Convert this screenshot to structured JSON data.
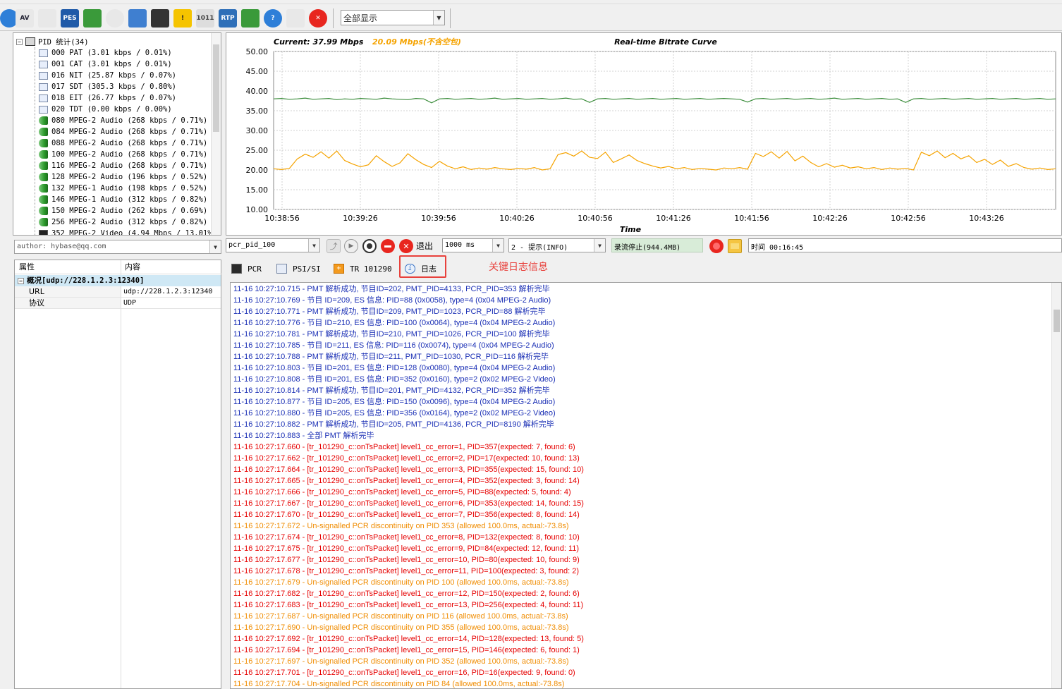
{
  "toolbar": {
    "buttons": [
      {
        "name": "globe-icon",
        "label": ""
      },
      {
        "name": "av-icon",
        "label": "AV"
      },
      {
        "name": "waveform-icon",
        "label": ""
      },
      {
        "name": "pes-icon",
        "label": "PES"
      },
      {
        "name": "line-chart-icon",
        "label": ""
      },
      {
        "name": "clock-icon",
        "label": ""
      },
      {
        "name": "bar-chart-icon",
        "label": ""
      },
      {
        "name": "monitor-icon",
        "label": ""
      },
      {
        "name": "warning-icon",
        "label": "!"
      },
      {
        "name": "binary-icon",
        "label": "1011"
      },
      {
        "name": "rtp-icon",
        "label": "RTP"
      },
      {
        "name": "image-icon",
        "label": ""
      },
      {
        "name": "help-icon",
        "label": "?"
      },
      {
        "name": "list-icon",
        "label": ""
      },
      {
        "name": "stop-icon",
        "label": "✕"
      }
    ],
    "view_mode": "全部显示"
  },
  "pid_tree": {
    "root_label": "PID 统计(34)",
    "items": [
      {
        "icon": "doc",
        "label": "000 PAT (3.01 kbps / 0.01%)"
      },
      {
        "icon": "doc",
        "label": "001 CAT (3.01 kbps / 0.01%)"
      },
      {
        "icon": "doc",
        "label": "016 NIT (25.87 kbps / 0.07%)"
      },
      {
        "icon": "doc",
        "label": "017 SDT (305.3 kbps / 0.80%)"
      },
      {
        "icon": "doc",
        "label": "018 EIT (26.77 kbps / 0.07%)"
      },
      {
        "icon": "doc",
        "label": "020 TDT (0.00 kbps / 0.00%)"
      },
      {
        "icon": "audio",
        "label": "080 MPEG-2 Audio (268 kbps / 0.71%)"
      },
      {
        "icon": "audio",
        "label": "084 MPEG-2 Audio (268 kbps / 0.71%)"
      },
      {
        "icon": "audio",
        "label": "088 MPEG-2 Audio (268 kbps / 0.71%)"
      },
      {
        "icon": "audio",
        "label": "100 MPEG-2 Audio (268 kbps / 0.71%)"
      },
      {
        "icon": "audio",
        "label": "116 MPEG-2 Audio (268 kbps / 0.71%)"
      },
      {
        "icon": "audio",
        "label": "128 MPEG-2 Audio (196 kbps / 0.52%)"
      },
      {
        "icon": "audio",
        "label": "132 MPEG-1 Audio (198 kbps / 0.52%)"
      },
      {
        "icon": "audio",
        "label": "146 MPEG-1 Audio (312 kbps / 0.82%)"
      },
      {
        "icon": "audio",
        "label": "150 MPEG-2 Audio (262 kbps / 0.69%)"
      },
      {
        "icon": "audio",
        "label": "256 MPEG-2 Audio (312 kbps / 0.82%)"
      },
      {
        "icon": "video",
        "label": "352 MPEG-2 Video (4.94 Mbps / 13.01%)"
      }
    ]
  },
  "author": "author: hybase@qq.com",
  "properties": {
    "col_property": "属性",
    "col_content": "内容",
    "group": "概况[udp://228.1.2.3:12340]",
    "rows": [
      {
        "key": "URL",
        "value": "udp://228.1.2.3:12340"
      },
      {
        "key": "协议",
        "value": "UDP"
      }
    ]
  },
  "chart_data": {
    "type": "line",
    "title": "Real-time Bitrate Curve",
    "current_label": "Current: 37.99 Mbps",
    "secondary_label": "20.09 Mbps(不含空包)",
    "xlabel": "Time",
    "ylabel": "",
    "ylim": [
      10,
      50
    ],
    "yticks": [
      "10.00",
      "15.00",
      "20.00",
      "25.00",
      "30.00",
      "35.00",
      "40.00",
      "45.00",
      "50.00"
    ],
    "x": [
      "10:38:56",
      "10:39:26",
      "10:39:56",
      "10:40:26",
      "10:40:56",
      "10:41:26",
      "10:41:56",
      "10:42:26",
      "10:42:56",
      "10:43:26"
    ],
    "colors": {
      "total": "#3f8f3f",
      "no_null": "#f5a300"
    },
    "series": [
      {
        "key": "total",
        "values": [
          38.0,
          38.1,
          37.9,
          38.0,
          38.2,
          37.9,
          38.0,
          38.1,
          37.8,
          38.0,
          37.9,
          38.1,
          38.0,
          37.9,
          38.2,
          38.0,
          37.9,
          37.8,
          38.1,
          38.0,
          37.0,
          38.0,
          38.1,
          37.9,
          38.0,
          38.1,
          37.9,
          38.0,
          38.2,
          37.9,
          38.0,
          38.1,
          37.9,
          38.0,
          38.1,
          37.9,
          38.0,
          38.2,
          37.9,
          38.0,
          37.1,
          38.0,
          38.1,
          37.9,
          38.0,
          38.1,
          37.9,
          38.0,
          38.1,
          37.9,
          38.0,
          38.1,
          37.9,
          38.0,
          38.1,
          37.9,
          38.0,
          38.1,
          38.0,
          37.9,
          37.2,
          38.0,
          38.1,
          37.9,
          38.0,
          38.1,
          37.9,
          38.0,
          38.1,
          37.9,
          38.0,
          38.2,
          37.9,
          38.0,
          38.1,
          37.9,
          38.0,
          38.1,
          37.9,
          38.0,
          37.1,
          38.0,
          38.1,
          37.9,
          38.0,
          38.1,
          37.9,
          38.0,
          38.1,
          37.9,
          38.0,
          38.1,
          37.9,
          38.0,
          38.1,
          37.9,
          38.0,
          38.1,
          37.9,
          38.0
        ]
      },
      {
        "key": "no_null",
        "values": [
          20.3,
          20.1,
          20.4,
          22.8,
          24.0,
          23.2,
          24.6,
          23.0,
          24.8,
          22.4,
          21.5,
          20.8,
          21.3,
          23.6,
          22.1,
          20.9,
          21.8,
          24.1,
          22.6,
          21.4,
          20.6,
          22.2,
          21.0,
          20.3,
          20.8,
          20.1,
          20.5,
          20.2,
          20.6,
          20.3,
          20.1,
          20.4,
          20.2,
          20.6,
          20.0,
          20.3,
          23.9,
          24.4,
          23.5,
          24.8,
          23.2,
          22.9,
          24.5,
          21.9,
          22.8,
          23.8,
          22.4,
          21.6,
          21.0,
          20.5,
          20.9,
          20.3,
          20.6,
          20.1,
          20.4,
          20.2,
          20.0,
          20.5,
          20.3,
          20.6,
          20.2,
          24.2,
          23.4,
          24.6,
          23.0,
          24.7,
          22.3,
          23.5,
          21.9,
          20.8,
          21.6,
          20.7,
          21.2,
          20.5,
          20.8,
          20.3,
          20.6,
          20.1,
          20.5,
          20.2,
          20.4,
          20.0,
          24.5,
          23.6,
          24.8,
          23.1,
          24.2,
          22.8,
          23.6,
          21.9,
          22.7,
          21.4,
          22.5,
          20.9,
          21.6,
          20.6,
          20.2,
          20.5,
          20.1,
          20.3
        ]
      }
    ]
  },
  "controls": {
    "pid_select": "pcr_pid_100",
    "exit_label": "退出",
    "interval_select": "1000 ms",
    "log_level_select": "2 - 提示(INFO)",
    "record_status": "录流停止(944.4MB)",
    "time_label": "时间 00:16:45"
  },
  "tabs": [
    {
      "name": "pcr",
      "label": "PCR"
    },
    {
      "name": "psisi",
      "label": "PSI/SI"
    },
    {
      "name": "tr101290",
      "label": "TR 101290"
    },
    {
      "name": "log",
      "label": "日志"
    }
  ],
  "annotation": "关键日志信息",
  "log": [
    {
      "level": "info",
      "text": "11-16 10:27:10.715 - PMT 解析成功, 节目ID=202, PMT_PID=4133, PCR_PID=353 解析完毕"
    },
    {
      "level": "info",
      "text": "11-16 10:27:10.769 - 节目 ID=209, ES 信息: PID=88 (0x0058), type=4 (0x04 MPEG-2 Audio)"
    },
    {
      "level": "info",
      "text": "11-16 10:27:10.771 - PMT 解析成功, 节目ID=209, PMT_PID=1023, PCR_PID=88 解析完毕"
    },
    {
      "level": "info",
      "text": "11-16 10:27:10.776 - 节目 ID=210, ES 信息: PID=100 (0x0064), type=4 (0x04 MPEG-2 Audio)"
    },
    {
      "level": "info",
      "text": "11-16 10:27:10.781 - PMT 解析成功, 节目ID=210, PMT_PID=1026, PCR_PID=100 解析完毕"
    },
    {
      "level": "info",
      "text": "11-16 10:27:10.785 - 节目 ID=211, ES 信息: PID=116 (0x0074), type=4 (0x04 MPEG-2 Audio)"
    },
    {
      "level": "info",
      "text": "11-16 10:27:10.788 - PMT 解析成功, 节目ID=211, PMT_PID=1030, PCR_PID=116 解析完毕"
    },
    {
      "level": "info",
      "text": "11-16 10:27:10.803 - 节目 ID=201, ES 信息: PID=128 (0x0080), type=4 (0x04 MPEG-2 Audio)"
    },
    {
      "level": "info",
      "text": "11-16 10:27:10.808 - 节目 ID=201, ES 信息: PID=352 (0x0160), type=2 (0x02 MPEG-2 Video)"
    },
    {
      "level": "info",
      "text": "11-16 10:27:10.814 - PMT 解析成功, 节目ID=201, PMT_PID=4132, PCR_PID=352 解析完毕"
    },
    {
      "level": "info",
      "text": "11-16 10:27:10.877 - 节目 ID=205, ES 信息: PID=150 (0x0096), type=4 (0x04 MPEG-2 Audio)"
    },
    {
      "level": "info",
      "text": "11-16 10:27:10.880 - 节目 ID=205, ES 信息: PID=356 (0x0164), type=2 (0x02 MPEG-2 Video)"
    },
    {
      "level": "info",
      "text": "11-16 10:27:10.882 - PMT 解析成功, 节目ID=205, PMT_PID=4136, PCR_PID=8190 解析完毕"
    },
    {
      "level": "info",
      "text": "11-16 10:27:10.883 - 全部 PMT 解析完毕"
    },
    {
      "level": "error",
      "text": "11-16 10:27:17.660 - [tr_101290_c::onTsPacket] level1_cc_error=1, PID=357(expected: 7, found: 6)"
    },
    {
      "level": "error",
      "text": "11-16 10:27:17.662 - [tr_101290_c::onTsPacket] level1_cc_error=2, PID=17(expected: 10, found: 13)"
    },
    {
      "level": "error",
      "text": "11-16 10:27:17.664 - [tr_101290_c::onTsPacket] level1_cc_error=3, PID=355(expected: 15, found: 10)"
    },
    {
      "level": "error",
      "text": "11-16 10:27:17.665 - [tr_101290_c::onTsPacket] level1_cc_error=4, PID=352(expected: 3, found: 14)"
    },
    {
      "level": "error",
      "text": "11-16 10:27:17.666 - [tr_101290_c::onTsPacket] level1_cc_error=5, PID=88(expected: 5, found: 4)"
    },
    {
      "level": "error",
      "text": "11-16 10:27:17.667 - [tr_101290_c::onTsPacket] level1_cc_error=6, PID=353(expected: 14, found: 15)"
    },
    {
      "level": "error",
      "text": "11-16 10:27:17.670 - [tr_101290_c::onTsPacket] level1_cc_error=7, PID=356(expected: 8, found: 14)"
    },
    {
      "level": "warn",
      "text": "11-16 10:27:17.672 - Un-signalled PCR discontinuity on PID 353 (allowed 100.0ms, actual:-73.8s)"
    },
    {
      "level": "error",
      "text": "11-16 10:27:17.674 - [tr_101290_c::onTsPacket] level1_cc_error=8, PID=132(expected: 8, found: 10)"
    },
    {
      "level": "error",
      "text": "11-16 10:27:17.675 - [tr_101290_c::onTsPacket] level1_cc_error=9, PID=84(expected: 12, found: 11)"
    },
    {
      "level": "error",
      "text": "11-16 10:27:17.677 - [tr_101290_c::onTsPacket] level1_cc_error=10, PID=80(expected: 10, found: 9)"
    },
    {
      "level": "error",
      "text": "11-16 10:27:17.678 - [tr_101290_c::onTsPacket] level1_cc_error=11, PID=100(expected: 3, found: 2)"
    },
    {
      "level": "warn",
      "text": "11-16 10:27:17.679 - Un-signalled PCR discontinuity on PID 100 (allowed 100.0ms, actual:-73.8s)"
    },
    {
      "level": "error",
      "text": "11-16 10:27:17.682 - [tr_101290_c::onTsPacket] level1_cc_error=12, PID=150(expected: 2, found: 6)"
    },
    {
      "level": "error",
      "text": "11-16 10:27:17.683 - [tr_101290_c::onTsPacket] level1_cc_error=13, PID=256(expected: 4, found: 11)"
    },
    {
      "level": "warn",
      "text": "11-16 10:27:17.687 - Un-signalled PCR discontinuity on PID 116 (allowed 100.0ms, actual:-73.8s)"
    },
    {
      "level": "warn",
      "text": "11-16 10:27:17.690 - Un-signalled PCR discontinuity on PID 355 (allowed 100.0ms, actual:-73.8s)"
    },
    {
      "level": "error",
      "text": "11-16 10:27:17.692 - [tr_101290_c::onTsPacket] level1_cc_error=14, PID=128(expected: 13, found: 5)"
    },
    {
      "level": "error",
      "text": "11-16 10:27:17.694 - [tr_101290_c::onTsPacket] level1_cc_error=15, PID=146(expected: 6, found: 1)"
    },
    {
      "level": "warn",
      "text": "11-16 10:27:17.697 - Un-signalled PCR discontinuity on PID 352 (allowed 100.0ms, actual:-73.8s)"
    },
    {
      "level": "error",
      "text": "11-16 10:27:17.701 - [tr_101290_c::onTsPacket] level1_cc_error=16, PID=16(expected: 9, found: 0)"
    },
    {
      "level": "warn",
      "text": "11-16 10:27:17.704 - Un-signalled PCR discontinuity on PID 84 (allowed 100.0ms, actual:-73.8s)"
    }
  ]
}
